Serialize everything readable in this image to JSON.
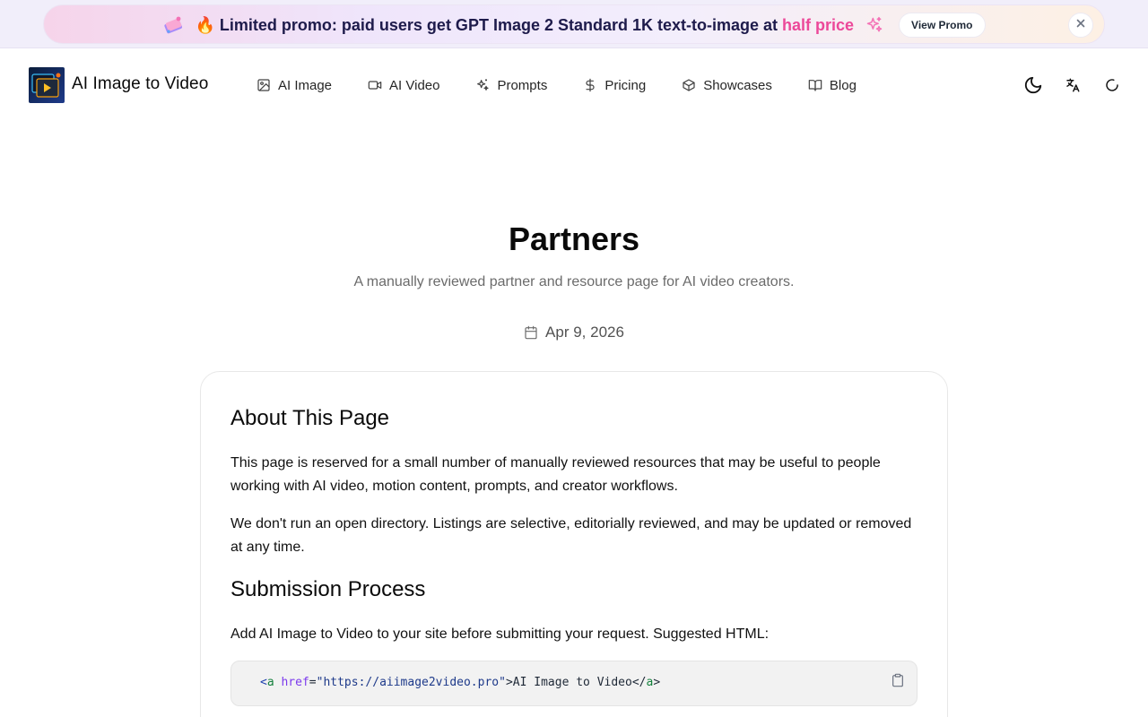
{
  "promo": {
    "left_emoji_icon": "gift-ticket-icon",
    "fire": "🔥",
    "text_main": "Limited promo: paid users get GPT Image 2 Standard 1K text-to-image at ",
    "text_highlight": "half price",
    "right_emoji_icon": "sparkles-icon",
    "button_label": "View Promo",
    "close_icon": "close-icon",
    "highlight_color": "#ec4899"
  },
  "header": {
    "brand": "AI Image to Video",
    "nav": [
      {
        "label": "AI Image",
        "icon": "image-icon"
      },
      {
        "label": "AI Video",
        "icon": "video-icon"
      },
      {
        "label": "Prompts",
        "icon": "sparkles-icon"
      },
      {
        "label": "Pricing",
        "icon": "dollar-icon"
      },
      {
        "label": "Showcases",
        "icon": "box-icon"
      },
      {
        "label": "Blog",
        "icon": "book-icon"
      }
    ],
    "tools": [
      "theme-toggle-icon",
      "language-icon",
      "loading-icon"
    ]
  },
  "hero": {
    "title": "Partners",
    "subtitle": "A manually reviewed partner and resource page for AI video creators.",
    "date": "Apr 9, 2026"
  },
  "content": {
    "about_heading": "About This Page",
    "about_p1": "This page is reserved for a small number of manually reviewed resources that may be useful to people working with AI video, motion content, prompts, and creator workflows.",
    "about_p2": "We don't run an open directory. Listings are selective, editorially reviewed, and may be updated or removed at any time.",
    "submission_heading": "Submission Process",
    "submission_p": "Add AI Image to Video to your site before submitting your request. Suggested HTML:",
    "code": {
      "open_lt": "<",
      "tag": "a",
      "attr": "href",
      "eq": "=",
      "value": "\"https://aiimage2video.pro\"",
      "gt": ">",
      "inner": "AI Image to Video",
      "close_lt": "</",
      "close_tag": "a",
      "close_gt": ">"
    }
  }
}
